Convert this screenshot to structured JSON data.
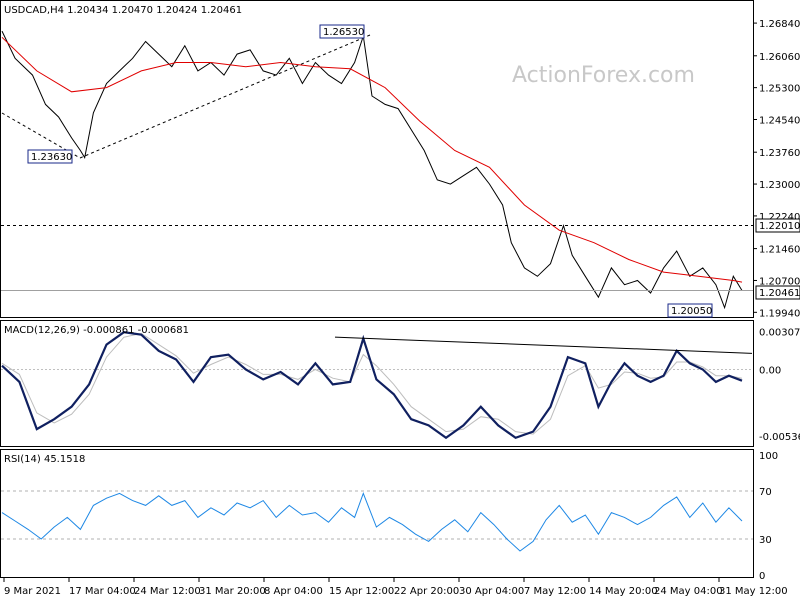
{
  "header": {
    "symbol_line": "USDCAD,H4  1.20434 1.20470 1.20424 1.20461",
    "watermark": "ActionForex.com"
  },
  "chart_data": [
    {
      "type": "candlestick",
      "title": "USDCAD,H4  1.20434 1.20470 1.20424 1.20461",
      "ylim": [
        1.199,
        1.272
      ],
      "y_ticks": [
        "1.26840",
        "1.26060",
        "1.25300",
        "1.24540",
        "1.23760",
        "1.23000",
        "1.22240",
        "1.21460",
        "1.20700",
        "1.19940"
      ],
      "x_ticks": [
        "9 Mar 2021",
        "17 Mar 04:00",
        "24 Mar 12:00",
        "31 Mar 20:00",
        "8 Apr 04:00",
        "15 Apr 12:00",
        "22 Apr 20:00",
        "30 Apr 04:00",
        "7 May 12:00",
        "14 May 20:00",
        "24 May 04:00",
        "31 May 12:00"
      ],
      "last_price": "1.20461",
      "horizontal_level": "1.22010",
      "annotations": [
        "1.23630",
        "1.26530",
        "1.20050"
      ],
      "price_path": [
        [
          0,
          1.2665
        ],
        [
          3,
          1.26
        ],
        [
          7,
          1.256
        ],
        [
          10,
          1.249
        ],
        [
          13,
          1.246
        ],
        [
          16,
          1.241
        ],
        [
          18,
          1.238
        ],
        [
          19,
          1.2363
        ],
        [
          21,
          1.247
        ],
        [
          24,
          1.254
        ],
        [
          27,
          1.257
        ],
        [
          30,
          1.26
        ],
        [
          33,
          1.264
        ],
        [
          36,
          1.261
        ],
        [
          39,
          1.258
        ],
        [
          42,
          1.263
        ],
        [
          45,
          1.257
        ],
        [
          48,
          1.259
        ],
        [
          51,
          1.256
        ],
        [
          54,
          1.261
        ],
        [
          57,
          1.262
        ],
        [
          60,
          1.257
        ],
        [
          63,
          1.256
        ],
        [
          66,
          1.26
        ],
        [
          69,
          1.254
        ],
        [
          72,
          1.259
        ],
        [
          75,
          1.256
        ],
        [
          78,
          1.254
        ],
        [
          81,
          1.259
        ],
        [
          83,
          1.2653
        ],
        [
          85,
          1.251
        ],
        [
          88,
          1.249
        ],
        [
          91,
          1.248
        ],
        [
          94,
          1.243
        ],
        [
          97,
          1.238
        ],
        [
          100,
          1.231
        ],
        [
          103,
          1.23
        ],
        [
          106,
          1.232
        ],
        [
          109,
          1.234
        ],
        [
          112,
          1.23
        ],
        [
          115,
          1.225
        ],
        [
          117,
          1.216
        ],
        [
          120,
          1.21
        ],
        [
          123,
          1.208
        ],
        [
          126,
          1.211
        ],
        [
          129,
          1.2201
        ],
        [
          131,
          1.213
        ],
        [
          134,
          1.208
        ],
        [
          137,
          1.203
        ],
        [
          140,
          1.21
        ],
        [
          143,
          1.206
        ],
        [
          146,
          1.207
        ],
        [
          149,
          1.204
        ],
        [
          152,
          1.21
        ],
        [
          155,
          1.214
        ],
        [
          158,
          1.208
        ],
        [
          161,
          1.21
        ],
        [
          164,
          1.206
        ],
        [
          166,
          1.2005
        ],
        [
          168,
          1.208
        ],
        [
          170,
          1.2046
        ]
      ],
      "ma_path": [
        [
          0,
          1.265
        ],
        [
          8,
          1.257
        ],
        [
          16,
          1.252
        ],
        [
          24,
          1.253
        ],
        [
          32,
          1.257
        ],
        [
          40,
          1.259
        ],
        [
          48,
          1.259
        ],
        [
          56,
          1.258
        ],
        [
          64,
          1.259
        ],
        [
          72,
          1.258
        ],
        [
          80,
          1.2575
        ],
        [
          88,
          1.253
        ],
        [
          96,
          1.245
        ],
        [
          104,
          1.238
        ],
        [
          112,
          1.234
        ],
        [
          120,
          1.225
        ],
        [
          128,
          1.219
        ],
        [
          136,
          1.216
        ],
        [
          144,
          1.212
        ],
        [
          152,
          1.209
        ],
        [
          160,
          1.208
        ],
        [
          168,
          1.207
        ],
        [
          170,
          1.2066
        ]
      ]
    },
    {
      "type": "line",
      "title": "MACD(12,26,9) -0.000861 -0.000681",
      "ylim": [
        -0.006,
        0.0035
      ],
      "y_ticks": [
        "0.003072",
        "0.00",
        "-0.005369"
      ],
      "series": [
        {
          "values": [
            [
              0,
              0.0003
            ],
            [
              4,
              -0.001
            ],
            [
              8,
              -0.0048
            ],
            [
              12,
              -0.004
            ],
            [
              16,
              -0.003
            ],
            [
              20,
              -0.0012
            ],
            [
              24,
              0.002
            ],
            [
              28,
              0.003
            ],
            [
              32,
              0.0028
            ],
            [
              36,
              0.0015
            ],
            [
              40,
              0.0008
            ],
            [
              44,
              -0.001
            ],
            [
              48,
              0.001
            ],
            [
              52,
              0.0012
            ],
            [
              56,
              0.0
            ],
            [
              60,
              -0.0008
            ],
            [
              64,
              -0.0002
            ],
            [
              68,
              -0.0012
            ],
            [
              72,
              0.0005
            ],
            [
              76,
              -0.0012
            ],
            [
              80,
              -0.001
            ],
            [
              83,
              0.0025
            ],
            [
              86,
              -0.0008
            ],
            [
              90,
              -0.002
            ],
            [
              94,
              -0.004
            ],
            [
              98,
              -0.0045
            ],
            [
              102,
              -0.0055
            ],
            [
              106,
              -0.0045
            ],
            [
              110,
              -0.003
            ],
            [
              114,
              -0.0045
            ],
            [
              118,
              -0.0055
            ],
            [
              122,
              -0.005
            ],
            [
              126,
              -0.003
            ],
            [
              130,
              0.001
            ],
            [
              134,
              0.0005
            ],
            [
              137,
              -0.003
            ],
            [
              140,
              -0.001
            ],
            [
              143,
              0.0005
            ],
            [
              146,
              -0.0005
            ],
            [
              149,
              -0.001
            ],
            [
              152,
              -0.0005
            ],
            [
              155,
              0.0015
            ],
            [
              158,
              0.0005
            ],
            [
              161,
              0.0
            ],
            [
              164,
              -0.001
            ],
            [
              167,
              -0.0005
            ],
            [
              170,
              -0.0009
            ]
          ]
        },
        {
          "values": [
            [
              0,
              0.0005
            ],
            [
              4,
              -0.0004
            ],
            [
              8,
              -0.0035
            ],
            [
              12,
              -0.0043
            ],
            [
              16,
              -0.0036
            ],
            [
              20,
              -0.002
            ],
            [
              24,
              0.001
            ],
            [
              28,
              0.0026
            ],
            [
              32,
              0.0029
            ],
            [
              36,
              0.002
            ],
            [
              40,
              0.0011
            ],
            [
              44,
              -0.0003
            ],
            [
              48,
              0.0004
            ],
            [
              52,
              0.001
            ],
            [
              56,
              0.0004
            ],
            [
              60,
              -0.0004
            ],
            [
              64,
              -0.0004
            ],
            [
              68,
              -0.0008
            ],
            [
              72,
              0.0
            ],
            [
              76,
              -0.0007
            ],
            [
              80,
              -0.001
            ],
            [
              83,
              0.0012
            ],
            [
              86,
              0.0003
            ],
            [
              90,
              -0.0012
            ],
            [
              94,
              -0.003
            ],
            [
              98,
              -0.004
            ],
            [
              102,
              -0.005
            ],
            [
              106,
              -0.0048
            ],
            [
              110,
              -0.0038
            ],
            [
              114,
              -0.004
            ],
            [
              118,
              -0.005
            ],
            [
              122,
              -0.0052
            ],
            [
              126,
              -0.004
            ],
            [
              130,
              -0.0005
            ],
            [
              134,
              0.0003
            ],
            [
              137,
              -0.0015
            ],
            [
              140,
              -0.0012
            ],
            [
              143,
              -0.0002
            ],
            [
              146,
              -0.0003
            ],
            [
              149,
              -0.0007
            ],
            [
              152,
              -0.0006
            ],
            [
              155,
              0.0006
            ],
            [
              158,
              0.0006
            ],
            [
              161,
              0.0002
            ],
            [
              164,
              -0.0005
            ],
            [
              167,
              -0.0005
            ],
            [
              170,
              -0.0007
            ]
          ]
        }
      ],
      "trendline": [
        [
          83,
          0.0026
        ],
        [
          175,
          0.0013
        ]
      ]
    },
    {
      "type": "line",
      "title": "RSI(14) 45.1518",
      "ylim": [
        0,
        100
      ],
      "y_ticks": [
        "100",
        "70",
        "30",
        "0"
      ],
      "series": [
        {
          "values": [
            [
              0,
              52
            ],
            [
              3,
              45
            ],
            [
              6,
              38
            ],
            [
              9,
              30
            ],
            [
              12,
              40
            ],
            [
              15,
              48
            ],
            [
              18,
              38
            ],
            [
              21,
              58
            ],
            [
              24,
              64
            ],
            [
              27,
              68
            ],
            [
              30,
              62
            ],
            [
              33,
              58
            ],
            [
              36,
              66
            ],
            [
              39,
              58
            ],
            [
              42,
              62
            ],
            [
              45,
              48
            ],
            [
              48,
              56
            ],
            [
              51,
              50
            ],
            [
              54,
              60
            ],
            [
              57,
              56
            ],
            [
              60,
              62
            ],
            [
              63,
              48
            ],
            [
              66,
              58
            ],
            [
              69,
              50
            ],
            [
              72,
              52
            ],
            [
              75,
              44
            ],
            [
              78,
              56
            ],
            [
              81,
              48
            ],
            [
              83,
              68
            ],
            [
              86,
              40
            ],
            [
              89,
              48
            ],
            [
              92,
              42
            ],
            [
              95,
              34
            ],
            [
              98,
              28
            ],
            [
              101,
              38
            ],
            [
              104,
              46
            ],
            [
              107,
              36
            ],
            [
              110,
              52
            ],
            [
              113,
              42
            ],
            [
              116,
              30
            ],
            [
              119,
              20
            ],
            [
              122,
              28
            ],
            [
              125,
              46
            ],
            [
              128,
              58
            ],
            [
              131,
              44
            ],
            [
              134,
              50
            ],
            [
              137,
              34
            ],
            [
              140,
              52
            ],
            [
              143,
              48
            ],
            [
              146,
              42
            ],
            [
              149,
              48
            ],
            [
              152,
              58
            ],
            [
              155,
              65
            ],
            [
              158,
              48
            ],
            [
              161,
              60
            ],
            [
              164,
              44
            ],
            [
              167,
              56
            ],
            [
              170,
              45
            ]
          ]
        }
      ]
    }
  ]
}
